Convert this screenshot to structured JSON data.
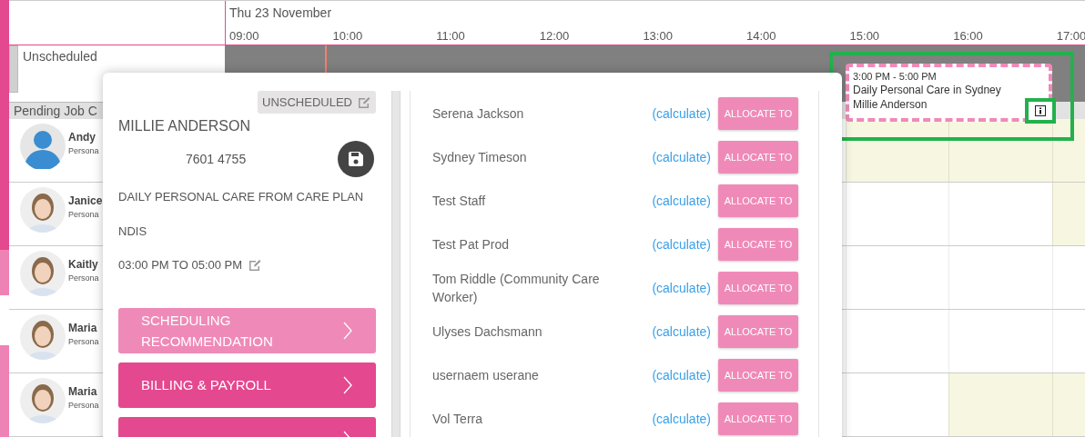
{
  "timeline": {
    "date": "Thu 23 November",
    "hours": [
      "09:00",
      "10:00",
      "11:00",
      "12:00",
      "13:00",
      "14:00",
      "15:00",
      "16:00",
      "17:00"
    ]
  },
  "unscheduled": {
    "label": "Unscheduled",
    "event": {
      "time": "3:00 PM - 5:00 PM",
      "title": "Daily Personal Care in Sydney",
      "client": "Millie Anderson"
    }
  },
  "pending": {
    "header": "Pending Job C"
  },
  "staff": [
    {
      "name": "Andy",
      "role": "Persona",
      "kind": "placeholder",
      "slots": [
        {
          "available": true
        },
        {
          "available": true
        },
        {
          "available": true
        }
      ]
    },
    {
      "name": "Janice",
      "role": "Persona",
      "slots": [
        {
          "available": false
        },
        {
          "available": false
        },
        {
          "available": true
        }
      ]
    },
    {
      "name": "Kaitly",
      "role": "Persona",
      "slots": [
        {
          "available": false
        },
        {
          "available": false
        },
        {
          "available": false
        }
      ]
    },
    {
      "name": "Maria",
      "role": "Persona",
      "slots": [
        {
          "available": false
        },
        {
          "available": false
        },
        {
          "available": false
        }
      ]
    },
    {
      "name": "Maria",
      "role": "Persona",
      "slots": [
        {
          "available": false
        },
        {
          "available": true
        },
        {
          "available": true
        }
      ]
    }
  ],
  "popup": {
    "status": "UNSCHEDULED",
    "client": "MILLIE ANDERSON",
    "phone": "7601 4755",
    "service": "DAILY PERSONAL CARE FROM CARE PLAN",
    "funding": "NDIS",
    "time": "03:00 PM TO 05:00 PM",
    "sections": [
      {
        "label": "SCHEDULING RECOMMENDATION",
        "kind": "light"
      },
      {
        "label": "BILLING & PAYROLL",
        "kind": "dark"
      },
      {
        "kind": "dark"
      }
    ],
    "candidates": [
      {
        "name": "Serena Jackson",
        "link": "(calculate)",
        "action": "ALLOCATE TO"
      },
      {
        "name": "Sydney Timeson",
        "link": "(calculate)",
        "action": "ALLOCATE TO"
      },
      {
        "name": "Test Staff",
        "link": "(calculate)",
        "action": "ALLOCATE TO"
      },
      {
        "name": "Test Pat Prod",
        "link": "(calculate)",
        "action": "ALLOCATE TO"
      },
      {
        "name": "Tom Riddle (Community Care Worker)",
        "link": "(calculate)",
        "action": "ALLOCATE TO"
      },
      {
        "name": "Ulyses Dachsmann",
        "link": "(calculate)",
        "action": "ALLOCATE TO"
      },
      {
        "name": "usernaem userane",
        "link": "(calculate)",
        "action": "ALLOCATE TO"
      },
      {
        "name": "Vol Terra",
        "link": "(calculate)",
        "action": "ALLOCATE TO"
      }
    ]
  }
}
